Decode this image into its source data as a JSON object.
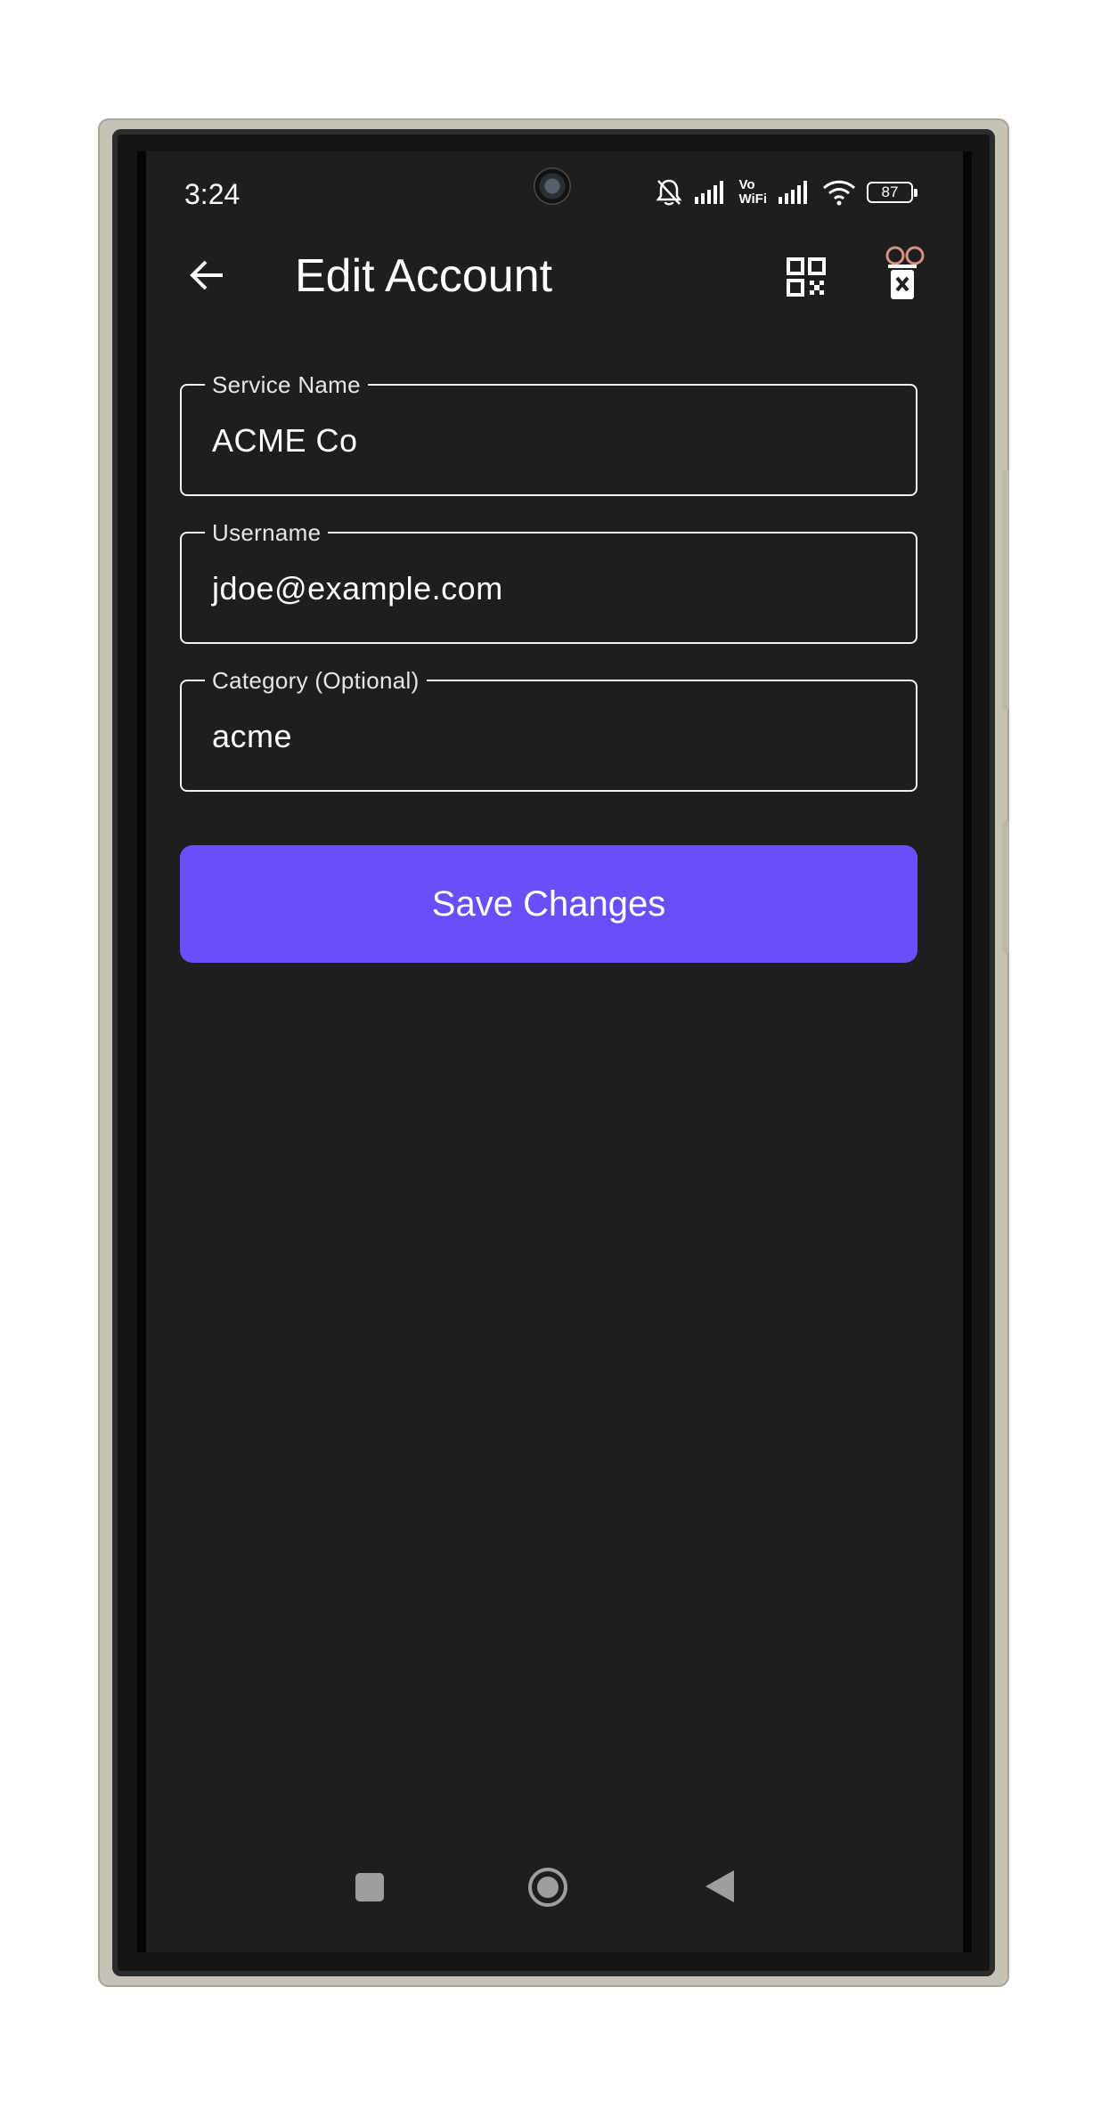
{
  "status_bar": {
    "time": "3:24",
    "wifi_calling_top": "Vo",
    "wifi_calling_bottom": "WiFi",
    "battery_level": "87"
  },
  "app_bar": {
    "title": "Edit Account",
    "back_icon": "arrow-back-icon",
    "qr_icon": "qr-code-icon",
    "delete_icon": "delete-icon"
  },
  "form": {
    "service_name": {
      "label": "Service Name",
      "value": "ACME Co"
    },
    "username": {
      "label": "Username",
      "value": "jdoe@example.com"
    },
    "category": {
      "label": "Category (Optional)",
      "value": "acme"
    }
  },
  "save_button": {
    "label": "Save Changes"
  },
  "colors": {
    "background": "#1e1e1e",
    "accent": "#684ff9",
    "text": "#ffffff"
  }
}
